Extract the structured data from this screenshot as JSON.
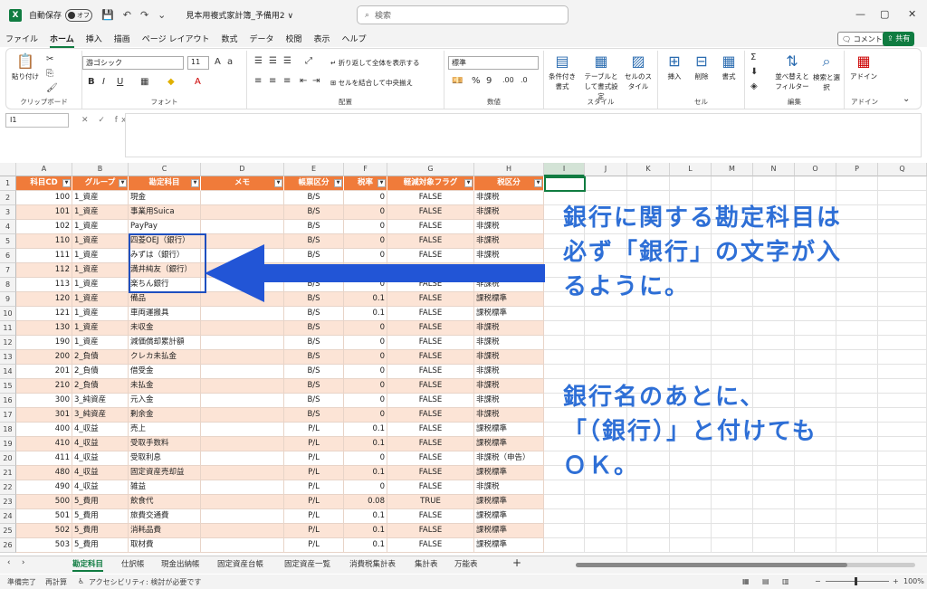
{
  "titlebar": {
    "app_icon": "X",
    "autosave_label": "自動保存",
    "autosave_state": "オフ",
    "filename": "見本用複式家計簿_予備用2 ∨",
    "search_placeholder": "検索",
    "minimize": "—",
    "restore": "▢",
    "close": "✕"
  },
  "menu": {
    "tabs": [
      "ファイル",
      "ホーム",
      "挿入",
      "描画",
      "ページ レイアウト",
      "数式",
      "データ",
      "校閲",
      "表示",
      "ヘルプ"
    ],
    "active": "ホーム",
    "comment_label": "コメント",
    "share_label": "共有"
  },
  "ribbon": {
    "clipboard": {
      "paste": "貼り付け",
      "label": "クリップボード"
    },
    "font": {
      "name": "游ゴシック",
      "size": "11",
      "label": "フォント",
      "bold": "B",
      "italic": "I",
      "underline": "U"
    },
    "alignment": {
      "wrap": "折り返して全体を表示する",
      "merge": "セルを結合して中央揃え",
      "label": "配置"
    },
    "number": {
      "format": "標準",
      "label": "数値"
    },
    "styles": {
      "conditional": "条件付き書式",
      "table": "テーブルとして書式設定",
      "cell": "セルのスタイル",
      "label": "スタイル"
    },
    "cells": {
      "insert": "挿入",
      "delete": "削除",
      "format": "書式",
      "label": "セル"
    },
    "editing": {
      "sort": "並べ替えとフィルター",
      "find": "検索と選択",
      "label": "編集"
    },
    "addin": {
      "addin": "アドイン",
      "label": "アドイン"
    }
  },
  "formula": {
    "namebox": "I1",
    "fx": "✕ ✓ fx"
  },
  "columns": [
    "A",
    "B",
    "C",
    "D",
    "E",
    "F",
    "G",
    "H",
    "I",
    "J",
    "K",
    "L",
    "M",
    "N",
    "O",
    "P",
    "Q"
  ],
  "headers": [
    "科目CD",
    "グループ",
    "勘定科目",
    "メモ",
    "帳票区分",
    "税率",
    "軽減対象フラグ",
    "税区分"
  ],
  "rows": [
    [
      "100",
      "1_資産",
      "現金",
      "",
      "B/S",
      "0",
      "FALSE",
      "非課税"
    ],
    [
      "101",
      "1_資産",
      "事業用Suica",
      "",
      "B/S",
      "0",
      "FALSE",
      "非課税"
    ],
    [
      "102",
      "1_資産",
      "PayPay",
      "",
      "B/S",
      "0",
      "FALSE",
      "非課税"
    ],
    [
      "110",
      "1_資産",
      "四菱OEJ（銀行）",
      "",
      "B/S",
      "0",
      "FALSE",
      "非課税"
    ],
    [
      "111",
      "1_資産",
      "みずは（銀行）",
      "",
      "B/S",
      "0",
      "FALSE",
      "非課税"
    ],
    [
      "112",
      "1_資産",
      "満井純友（銀行）",
      "",
      "B/S",
      "0",
      "FALSE",
      "非課税"
    ],
    [
      "113",
      "1_資産",
      "楽ちん銀行",
      "",
      "B/S",
      "0",
      "FALSE",
      "非課税"
    ],
    [
      "120",
      "1_資産",
      "備品",
      "",
      "B/S",
      "0.1",
      "FALSE",
      "課税標準"
    ],
    [
      "121",
      "1_資産",
      "車両運搬具",
      "",
      "B/S",
      "0.1",
      "FALSE",
      "課税標準"
    ],
    [
      "130",
      "1_資産",
      "未収金",
      "",
      "B/S",
      "0",
      "FALSE",
      "非課税"
    ],
    [
      "190",
      "1_資産",
      "減価償却累計額",
      "",
      "B/S",
      "0",
      "FALSE",
      "非課税"
    ],
    [
      "200",
      "2_負債",
      "クレカ未払金",
      "",
      "B/S",
      "0",
      "FALSE",
      "非課税"
    ],
    [
      "201",
      "2_負債",
      "借受金",
      "",
      "B/S",
      "0",
      "FALSE",
      "非課税"
    ],
    [
      "210",
      "2_負債",
      "未払金",
      "",
      "B/S",
      "0",
      "FALSE",
      "非課税"
    ],
    [
      "300",
      "3_純資産",
      "元入金",
      "",
      "B/S",
      "0",
      "FALSE",
      "非課税"
    ],
    [
      "301",
      "3_純資産",
      "剰余金",
      "",
      "B/S",
      "0",
      "FALSE",
      "非課税"
    ],
    [
      "400",
      "4_収益",
      "売上",
      "",
      "P/L",
      "0.1",
      "FALSE",
      "課税標準"
    ],
    [
      "410",
      "4_収益",
      "受取手数料",
      "",
      "P/L",
      "0.1",
      "FALSE",
      "課税標準"
    ],
    [
      "411",
      "4_収益",
      "受取利息",
      "",
      "P/L",
      "0",
      "FALSE",
      "非課税（申告）"
    ],
    [
      "480",
      "4_収益",
      "固定資産売却益",
      "",
      "P/L",
      "0.1",
      "FALSE",
      "課税標準"
    ],
    [
      "490",
      "4_収益",
      "雑益",
      "",
      "P/L",
      "0",
      "FALSE",
      "非課税"
    ],
    [
      "500",
      "5_費用",
      "飲食代",
      "",
      "P/L",
      "0.08",
      "TRUE",
      "課税標準"
    ],
    [
      "501",
      "5_費用",
      "旅費交通費",
      "",
      "P/L",
      "0.1",
      "FALSE",
      "課税標準"
    ],
    [
      "502",
      "5_費用",
      "消耗品費",
      "",
      "P/L",
      "0.1",
      "FALSE",
      "課税標準"
    ],
    [
      "503",
      "5_費用",
      "取材費",
      "",
      "P/L",
      "0.1",
      "FALSE",
      "課税標準"
    ]
  ],
  "annotation": {
    "lines_top": [
      "銀行に関する勘定科目は",
      "必ず「銀行」の文字が入",
      "るように。"
    ],
    "lines_bottom": [
      "銀行名のあとに、",
      "「（銀行）」と付けても",
      "ＯＫ。"
    ],
    "color": "#2e6fd6"
  },
  "sheet_tabs": [
    "勘定科目",
    "仕訳帳",
    "現金出納帳",
    "固定資産台帳",
    "固定資産一覧",
    "消費税集計表",
    "集計表",
    "万能表"
  ],
  "active_sheet": "勘定科目",
  "add_sheet": "+",
  "status": {
    "ready": "準備完了",
    "recalc": "再計算",
    "accessibility": "アクセシビリティ: 検討が必要です",
    "zoom": "100%",
    "zoom_minus": "−",
    "zoom_plus": "+"
  },
  "colors": {
    "header_bg": "#f07b3a",
    "band_bg": "#fce4d6",
    "accent": "#107c41"
  }
}
